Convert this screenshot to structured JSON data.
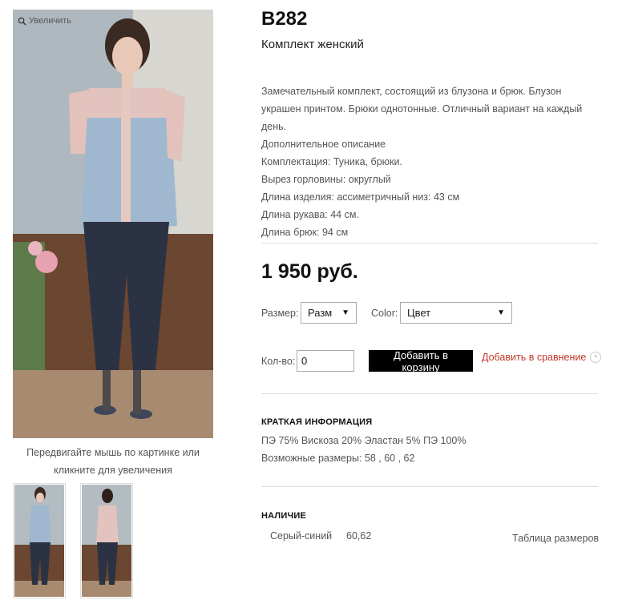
{
  "gallery": {
    "zoom_hint": "Увеличить",
    "caption": "Передвигайте мышь по картинке или кликните для увеличения"
  },
  "product": {
    "title": "B282",
    "subtitle": "Комплект женский",
    "description": [
      "Замечательный комплект, состоящий из блузона и брюк. Блузон украшен принтом. Брюки однотонные. Отличный вариант на каждый день.",
      "Дополнительное описание",
      "Комплектация: Туника, брюки.",
      "Вырез горловины: округлый",
      "Длина изделия: ассиметричный низ: 43 см",
      "Длина рукава: 44 см.",
      "Длина брюк: 94 см"
    ],
    "price": "1 950 руб."
  },
  "options": {
    "size_label": "Размер:",
    "size_value": "Разм",
    "color_label": "Color:",
    "color_value": "Цвет",
    "qty_label": "Кол-во:",
    "qty_value": "0",
    "add_to_cart": "Добавить в корзину",
    "add_to_compare": "Добавить в сравнение"
  },
  "short_info": {
    "title": "КРАТКАЯ ИНФОРМАЦИЯ",
    "composition": "ПЭ 75% Вискоза 20% Эластан 5% ПЭ 100%",
    "sizes": "Возможные размеры: 58 , 60 , 62"
  },
  "availability": {
    "title": "НАЛИЧИЕ",
    "color": "Серый-синий",
    "sizes": "60,62",
    "size_table_link": "Таблица размеров"
  }
}
